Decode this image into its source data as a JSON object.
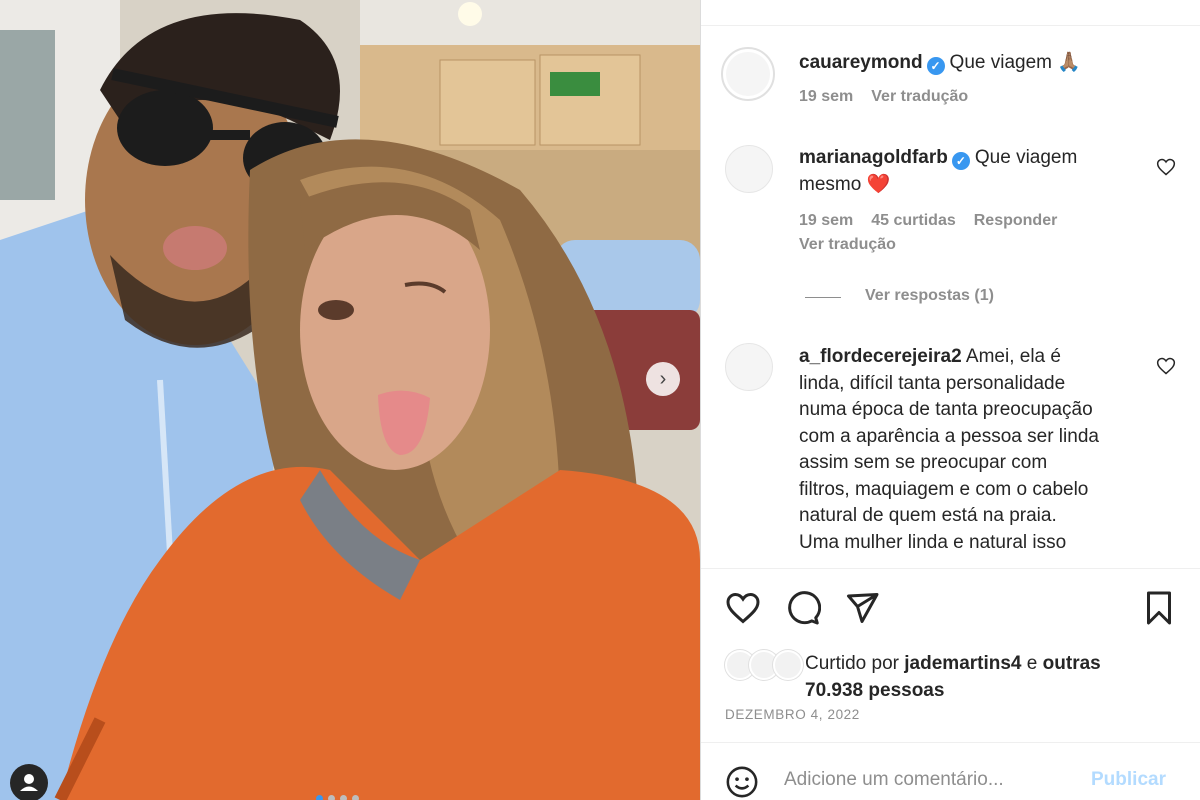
{
  "post": {
    "image_alt": "Selfie of a man with sunglasses and a woman with long wavy hair sticking out her tongue",
    "carousel_total": 4,
    "carousel_active": 1
  },
  "comments": [
    {
      "username": "cauareymond",
      "verified": true,
      "text": "Que viagem 🙏🏽",
      "time": "19 sem",
      "translate": "Ver tradução"
    },
    {
      "username": "marianagoldfarb",
      "verified": true,
      "text_line1": "Que viagem",
      "text_line2": "mesmo ❤️",
      "time": "19 sem",
      "likes": "45 curtidas",
      "reply": "Responder",
      "translate": "Ver tradução",
      "view_replies": "Ver respostas (1)"
    },
    {
      "username": "a_flordecerejeira2",
      "verified": false,
      "lines": [
        "Amei, ela é",
        "linda, difícil tanta personalidade",
        "numa época de tanta preocupação",
        "com a aparência a pessoa ser linda",
        "assim sem se preocupar com",
        "filtros, maquiagem e com o cabelo",
        "natural de quem está na praia.",
        "Uma mulher linda e natural isso"
      ]
    }
  ],
  "likes": {
    "prefix": "Curtido por",
    "user": "jademartins4",
    "connector": "e",
    "others": "outras",
    "count": "70.938 pessoas"
  },
  "date": "DEZEMBRO 4, 2022",
  "comment_box": {
    "placeholder": "Adicione um comentário...",
    "publish": "Publicar"
  },
  "colors": {
    "accent": "#3897f0",
    "publish_disabled": "#b3dbff",
    "heart_red": "#ed4956"
  }
}
